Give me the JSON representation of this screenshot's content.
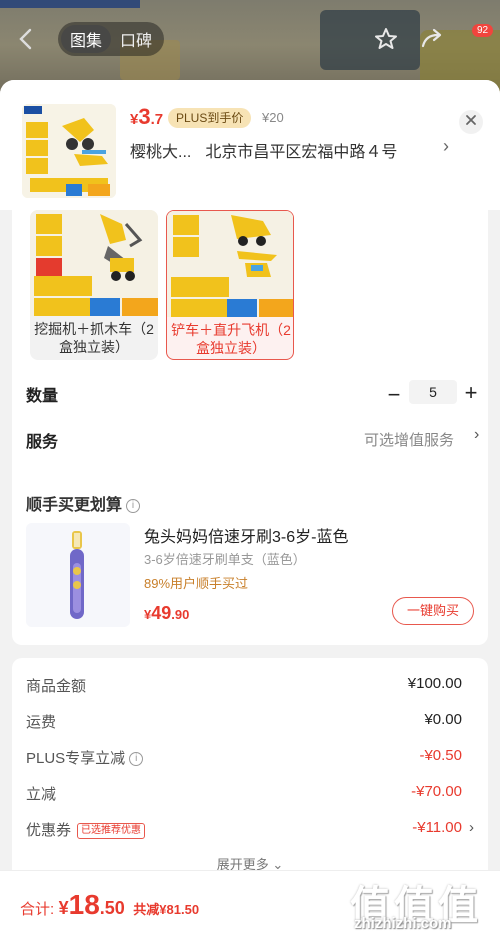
{
  "top_bar": {
    "back_icon": "chevron-left-icon",
    "tabs": [
      {
        "label": "图集",
        "active": true
      },
      {
        "label": "口碑",
        "active": false
      }
    ],
    "cart_badge": "92"
  },
  "header": {
    "price_currency": "¥",
    "price_int": "3",
    "price_dec": ".7",
    "plus_tag": "PLUS到手价",
    "original_price": "¥20",
    "selected_short": "樱桃大...",
    "address": "北京市昌平区宏福中路４号"
  },
  "variants": [
    {
      "label": "挖掘机＋抓木车（2盒独立装）",
      "selected": false
    },
    {
      "label": "铲车＋直升飞机（2盒独立装）",
      "selected": true
    }
  ],
  "quantity": {
    "label": "数量",
    "value": "5",
    "minus": "−",
    "plus": "+"
  },
  "service": {
    "label": "服务",
    "value": "可选增值服务"
  },
  "recommend": {
    "title": "顺手买更划算",
    "name": "兔头妈妈倍速牙刷3-6岁-蓝色",
    "sub": "3-6岁倍速牙刷单支（蓝色）",
    "pct": "89%用户顺手买过",
    "price_currency": "¥",
    "price_int": "49",
    "price_dec": ".90",
    "buy_label": "一键购买"
  },
  "summary": {
    "rows": [
      {
        "k": "商品金额",
        "v": "¥100.00"
      },
      {
        "k": "运费",
        "v": "¥0.00"
      },
      {
        "k": "PLUS专享立减",
        "v": "-¥0.50"
      },
      {
        "k": "立减",
        "v": "-¥70.00"
      },
      {
        "k": "优惠券",
        "v": "-¥11.00",
        "tag": "已选推荐优惠"
      }
    ],
    "expand": "展开更多"
  },
  "bottom": {
    "total_label": "合计:",
    "currency": "¥",
    "total_int": "18",
    "total_dec": ".50",
    "saved": "共减¥81.50"
  },
  "watermark": {
    "big": "值值值",
    "url": "zhizhizhi.com"
  },
  "colors": {
    "accent": "#e83a2e",
    "plus_bg": "#f7e3b5"
  }
}
